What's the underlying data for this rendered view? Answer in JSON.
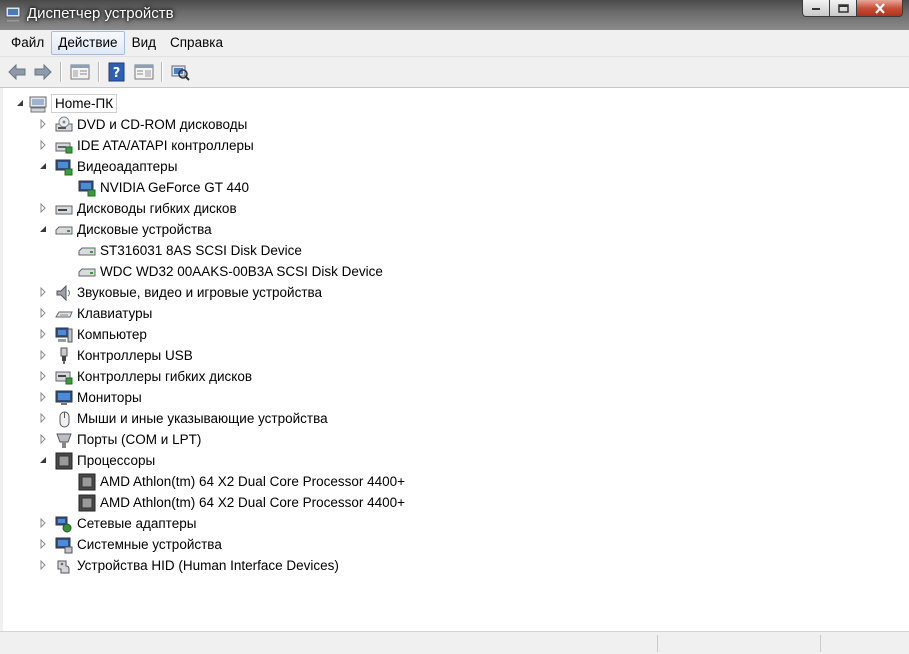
{
  "window": {
    "title": "Диспетчер устройств",
    "close_color": "#c7503a"
  },
  "menu": [
    {
      "label": "Файл"
    },
    {
      "label": "Действие"
    },
    {
      "label": "Вид"
    },
    {
      "label": "Справка"
    }
  ],
  "toolbar": {
    "buttons": [
      "back-arrow-icon",
      "forward-arrow-icon",
      "properties-pane-icon",
      "help-icon",
      "console-tree-icon",
      "scan-hardware-icon"
    ]
  },
  "tree": {
    "root": {
      "label": "Home-ПК",
      "icon": "computer-icon",
      "expanded": true
    },
    "categories": [
      {
        "label": "DVD и CD-ROM дисководы",
        "icon": "dvd-drive-icon",
        "expanded": false,
        "children": []
      },
      {
        "label": "IDE ATA/ATAPI контроллеры",
        "icon": "ide-controller-icon",
        "expanded": false,
        "children": []
      },
      {
        "label": "Видеоадаптеры",
        "icon": "display-adapter-icon",
        "expanded": true,
        "children": [
          "NVIDIA GeForce GT 440"
        ]
      },
      {
        "label": "Дисководы гибких дисков",
        "icon": "floppy-drive-icon",
        "expanded": false,
        "children": []
      },
      {
        "label": "Дисковые устройства",
        "icon": "disk-drive-icon",
        "expanded": true,
        "children": [
          "ST316031 8AS SCSI Disk Device",
          "WDC WD32 00AAKS-00B3A SCSI Disk Device"
        ]
      },
      {
        "label": "Звуковые, видео и игровые устройства",
        "icon": "speaker-icon",
        "expanded": false,
        "children": []
      },
      {
        "label": "Клавиатуры",
        "icon": "keyboard-icon",
        "expanded": false,
        "children": []
      },
      {
        "label": "Компьютер",
        "icon": "computer-icon",
        "expanded": false,
        "children": []
      },
      {
        "label": "Контроллеры USB",
        "icon": "usb-icon",
        "expanded": false,
        "children": []
      },
      {
        "label": "Контроллеры гибких дисков",
        "icon": "floppy-controller-icon",
        "expanded": false,
        "children": []
      },
      {
        "label": "Мониторы",
        "icon": "monitor-icon",
        "expanded": false,
        "children": []
      },
      {
        "label": "Мыши и иные указывающие устройства",
        "icon": "mouse-icon",
        "expanded": false,
        "children": []
      },
      {
        "label": "Порты (COM и LPT)",
        "icon": "port-icon",
        "expanded": false,
        "children": []
      },
      {
        "label": "Процессоры",
        "icon": "processor-icon",
        "expanded": true,
        "children": [
          "AMD Athlon(tm) 64 X2 Dual Core Processor 4400+",
          "AMD Athlon(tm) 64 X2 Dual Core Processor 4400+"
        ]
      },
      {
        "label": "Сетевые адаптеры",
        "icon": "network-adapter-icon",
        "expanded": false,
        "children": []
      },
      {
        "label": "Системные устройства",
        "icon": "system-device-icon",
        "expanded": false,
        "children": []
      },
      {
        "label": "Устройства HID (Human Interface Devices)",
        "icon": "hid-icon",
        "expanded": false,
        "children": []
      }
    ]
  }
}
